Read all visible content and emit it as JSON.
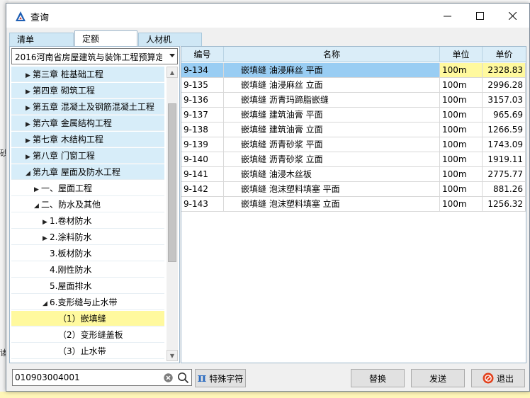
{
  "window": {
    "title": "查询"
  },
  "tabs": [
    {
      "label": "清单"
    },
    {
      "label": "定额"
    },
    {
      "label": "人材机"
    }
  ],
  "quota_selector": {
    "value": "2016河南省房屋建筑与装饰工程预算定额"
  },
  "tree": [
    {
      "label": "第三章 桩基础工程",
      "arrow": "▶"
    },
    {
      "label": "第四章 砌筑工程",
      "arrow": "▶"
    },
    {
      "label": "第五章 混凝土及钢筋混凝土工程",
      "arrow": "▶"
    },
    {
      "label": "第六章 金属结构工程",
      "arrow": "▶"
    },
    {
      "label": "第七章 木结构工程",
      "arrow": "▶"
    },
    {
      "label": "第八章 门窗工程",
      "arrow": "▶"
    },
    {
      "label": "第九章 屋面及防水工程",
      "arrow": "◢"
    },
    {
      "label": "一、屋面工程",
      "arrow": "▶"
    },
    {
      "label": "二、防水及其他",
      "arrow": "◢"
    },
    {
      "label": "1.卷材防水",
      "arrow": "▶"
    },
    {
      "label": "2.涂料防水",
      "arrow": "▶"
    },
    {
      "label": "3.板材防水",
      "arrow": ""
    },
    {
      "label": "4.刚性防水",
      "arrow": ""
    },
    {
      "label": "5.屋面排水",
      "arrow": ""
    },
    {
      "label": "6.变形缝与止水带",
      "arrow": "◢"
    },
    {
      "label": "（1）嵌填缝",
      "arrow": ""
    },
    {
      "label": "（2）变形缝盖板",
      "arrow": ""
    },
    {
      "label": "（3）止水带",
      "arrow": ""
    }
  ],
  "grid": {
    "headers": {
      "code": "编号",
      "name": "名称",
      "unit": "单位",
      "price": "单价"
    },
    "rows": [
      {
        "code": "9-134",
        "name": "嵌填缝 油浸麻丝 平面",
        "unit": "100m",
        "price": "2328.83"
      },
      {
        "code": "9-135",
        "name": "嵌填缝 油浸麻丝 立面",
        "unit": "100m",
        "price": "2996.28"
      },
      {
        "code": "9-136",
        "name": "嵌填缝 沥青玛蹄脂嵌缝",
        "unit": "100m",
        "price": "3157.03"
      },
      {
        "code": "9-137",
        "name": "嵌填缝 建筑油膏 平面",
        "unit": "100m",
        "price": "965.69"
      },
      {
        "code": "9-138",
        "name": "嵌填缝 建筑油膏 立面",
        "unit": "100m",
        "price": "1266.59"
      },
      {
        "code": "9-139",
        "name": "嵌填缝 沥青砂浆 平面",
        "unit": "100m",
        "price": "1743.09"
      },
      {
        "code": "9-140",
        "name": "嵌填缝 沥青砂浆 立面",
        "unit": "100m",
        "price": "1919.11"
      },
      {
        "code": "9-141",
        "name": "嵌填缝 油浸木丝板",
        "unit": "100m",
        "price": "2775.77"
      },
      {
        "code": "9-142",
        "name": "嵌填缝 泡沫塑料填塞 平面",
        "unit": "100m",
        "price": "881.26"
      },
      {
        "code": "9-143",
        "name": "嵌填缝 泡沫塑料填塞 立面",
        "unit": "100m",
        "price": "1256.32"
      }
    ]
  },
  "search": {
    "value": "010903004001"
  },
  "buttons": {
    "special_chars": "特殊字符",
    "replace": "替换",
    "send": "发送",
    "exit": "退出"
  },
  "background": {
    "left_glyphs": [
      "砂",
      "诸"
    ]
  },
  "colors": {
    "selected_row": "#99cdf3",
    "highlight": "#fff99e",
    "chapter_bg": "#d7edf9",
    "accent": "#2f6ec0"
  }
}
